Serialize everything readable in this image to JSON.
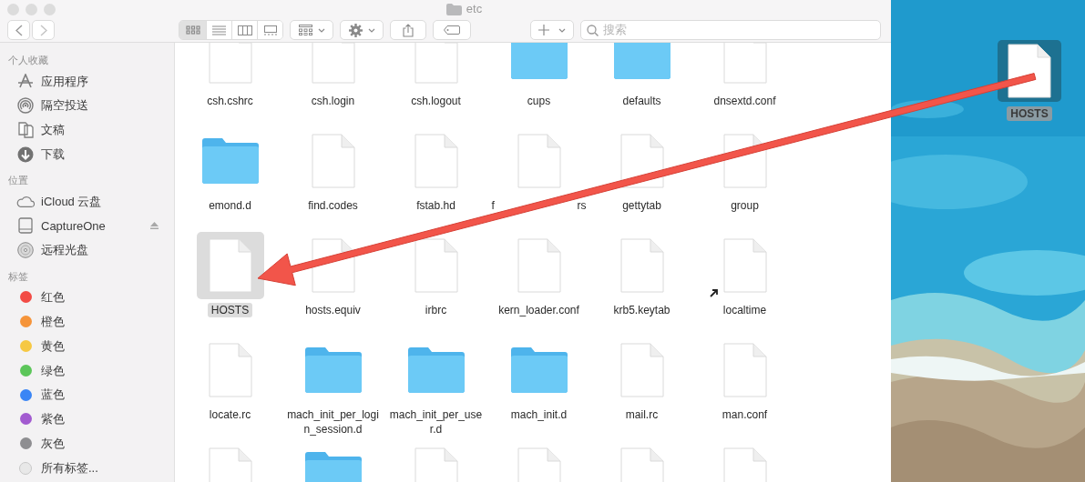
{
  "window": {
    "title": "etc"
  },
  "search": {
    "placeholder": "搜索"
  },
  "sidebar": {
    "sections": [
      {
        "title": "个人收藏",
        "items": [
          {
            "label": "应用程序",
            "kind": "apps"
          },
          {
            "label": "隔空投送",
            "kind": "airdrop"
          },
          {
            "label": "文稿",
            "kind": "documents"
          },
          {
            "label": "下载",
            "kind": "downloads"
          }
        ]
      },
      {
        "title": "位置",
        "items": [
          {
            "label": "iCloud 云盘",
            "kind": "icloud"
          },
          {
            "label": "CaptureOne",
            "kind": "disk",
            "ejectable": true
          },
          {
            "label": "远程光盘",
            "kind": "disc"
          }
        ]
      },
      {
        "title": "标签",
        "items": [
          {
            "label": "红色",
            "kind": "tag",
            "color": "#f24b45"
          },
          {
            "label": "橙色",
            "kind": "tag",
            "color": "#f5943a"
          },
          {
            "label": "黄色",
            "kind": "tag",
            "color": "#f6c843"
          },
          {
            "label": "绿色",
            "kind": "tag",
            "color": "#5cc65a"
          },
          {
            "label": "蓝色",
            "kind": "tag",
            "color": "#3a85f5"
          },
          {
            "label": "紫色",
            "kind": "tag",
            "color": "#a25bd0"
          },
          {
            "label": "灰色",
            "kind": "tag",
            "color": "#8e8e91"
          },
          {
            "label": "所有标签...",
            "kind": "all-tags"
          }
        ]
      }
    ]
  },
  "files": [
    {
      "name": "csh.cshrc",
      "kind": "file",
      "selected": false
    },
    {
      "name": "csh.login",
      "kind": "file",
      "selected": false
    },
    {
      "name": "csh.logout",
      "kind": "file",
      "selected": false
    },
    {
      "name": "cups",
      "kind": "folder",
      "selected": false
    },
    {
      "name": "defaults",
      "kind": "folder",
      "selected": false
    },
    {
      "name": "dnsextd.conf",
      "kind": "file",
      "selected": false
    },
    {
      "name": "emond.d",
      "kind": "folder",
      "selected": false
    },
    {
      "name": "find.codes",
      "kind": "file",
      "selected": false
    },
    {
      "name": "fstab.hd",
      "kind": "file",
      "selected": false
    },
    {
      "name": "f",
      "name_tail": "rs",
      "kind": "file",
      "selected": false
    },
    {
      "name": "gettytab",
      "kind": "file",
      "selected": false
    },
    {
      "name": "group",
      "kind": "file",
      "selected": false
    },
    {
      "name": "HOSTS",
      "kind": "file",
      "selected": true
    },
    {
      "name": "hosts.equiv",
      "kind": "file",
      "selected": false
    },
    {
      "name": "irbrc",
      "kind": "file",
      "selected": false
    },
    {
      "name": "kern_loader.conf",
      "kind": "file",
      "selected": false
    },
    {
      "name": "krb5.keytab",
      "kind": "file",
      "selected": false
    },
    {
      "name": "localtime",
      "kind": "alias",
      "selected": false
    },
    {
      "name": "locate.rc",
      "kind": "file",
      "selected": false
    },
    {
      "name": "mach_init_per_login_session.d",
      "kind": "folder",
      "selected": false
    },
    {
      "name": "mach_init_per_user.d",
      "kind": "folder",
      "selected": false
    },
    {
      "name": "mach_init.d",
      "kind": "folder",
      "selected": false
    },
    {
      "name": "mail.rc",
      "kind": "file",
      "selected": false
    },
    {
      "name": "man.conf",
      "kind": "file",
      "selected": false
    },
    {
      "kind": "file",
      "selected": false
    },
    {
      "kind": "folder",
      "selected": false
    },
    {
      "kind": "file",
      "selected": false
    },
    {
      "kind": "file",
      "selected": false
    },
    {
      "kind": "file",
      "selected": false
    },
    {
      "kind": "file",
      "selected": false
    }
  ],
  "desktop": {
    "items": [
      {
        "name": "HOSTS",
        "kind": "file",
        "selected": true
      }
    ]
  }
}
